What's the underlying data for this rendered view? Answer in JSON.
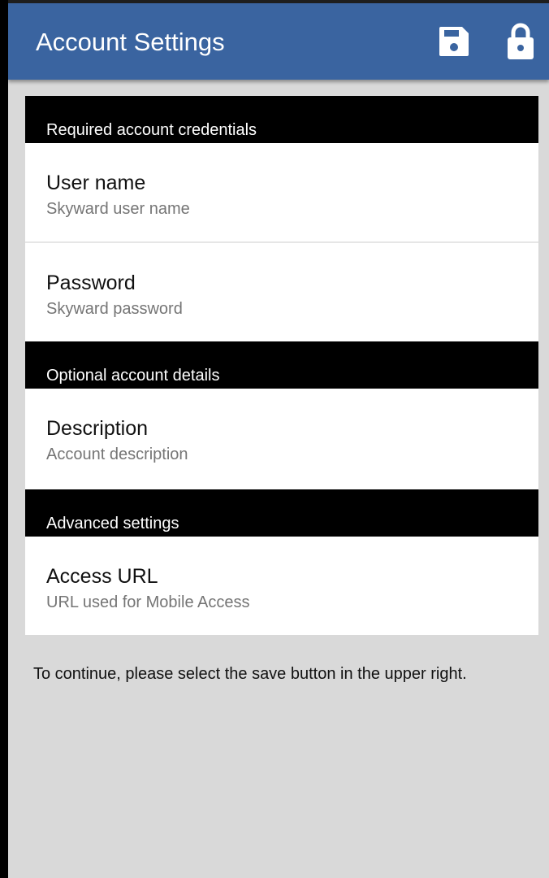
{
  "app_bar": {
    "title": "Account Settings",
    "background": "#3a64a0",
    "save_icon": "floppy-disk-icon",
    "lock_icon": "padlock-icon"
  },
  "sections": [
    {
      "label": "Required account credentials",
      "items": [
        {
          "title": "User name",
          "subtitle": "Skyward user name"
        },
        {
          "title": "Password",
          "subtitle": "Skyward password"
        }
      ]
    },
    {
      "label": "Optional account details",
      "items": [
        {
          "title": "Description",
          "subtitle": "Account description"
        }
      ]
    },
    {
      "label": "Advanced settings",
      "items": [
        {
          "title": "Access URL",
          "subtitle": "URL used for Mobile Access"
        }
      ]
    }
  ],
  "footer": {
    "message": "To continue, please select the save button in the upper right."
  }
}
